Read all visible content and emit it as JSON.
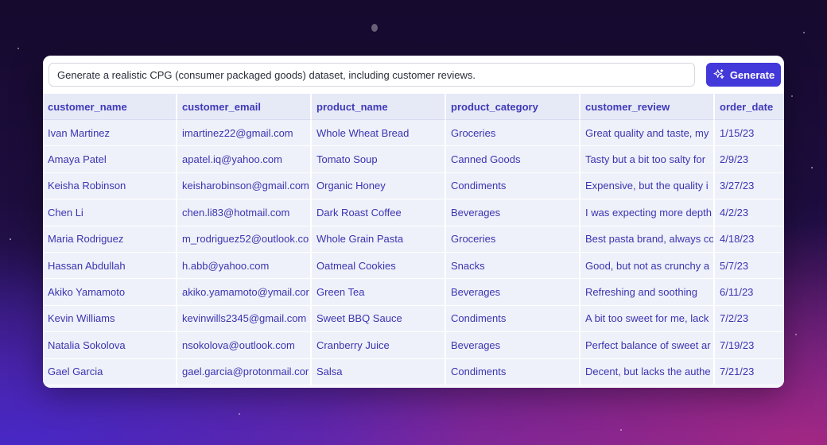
{
  "prompt": {
    "value": "Generate a realistic CPG (consumer packaged goods) dataset, including customer reviews.",
    "generate_label": "Generate",
    "generate_icon": "sparkles-icon"
  },
  "table": {
    "columns": [
      "customer_name",
      "customer_email",
      "product_name",
      "product_category",
      "customer_review",
      "order_date"
    ],
    "rows": [
      [
        "Ivan Martinez",
        "imartinez22@gmail.com",
        "Whole Wheat Bread",
        "Groceries",
        "Great quality and taste, my",
        "1/15/23"
      ],
      [
        "Amaya Patel",
        "apatel.iq@yahoo.com",
        "Tomato Soup",
        "Canned Goods",
        "Tasty but a bit too salty for",
        "2/9/23"
      ],
      [
        "Keisha Robinson",
        "keisharobinson@gmail.com",
        "Organic Honey",
        "Condiments",
        "Expensive, but the quality i",
        "3/27/23"
      ],
      [
        "Chen Li",
        "chen.li83@hotmail.com",
        "Dark Roast Coffee",
        "Beverages",
        "I was expecting more depth",
        "4/2/23"
      ],
      [
        "Maria Rodriguez",
        "m_rodriguez52@outlook.co",
        "Whole Grain Pasta",
        "Groceries",
        "Best pasta brand, always co",
        "4/18/23"
      ],
      [
        "Hassan Abdullah",
        "h.abb@yahoo.com",
        "Oatmeal Cookies",
        "Snacks",
        "Good, but not as crunchy a",
        "5/7/23"
      ],
      [
        "Akiko Yamamoto",
        "akiko.yamamoto@ymail.cor",
        "Green Tea",
        "Beverages",
        "Refreshing and soothing",
        "6/11/23"
      ],
      [
        "Kevin Williams",
        "kevinwills2345@gmail.com",
        "Sweet BBQ Sauce",
        "Condiments",
        "A bit too sweet for me, lack",
        "7/2/23"
      ],
      [
        "Natalia Sokolova",
        "nsokolova@outlook.com",
        "Cranberry Juice",
        "Beverages",
        "Perfect balance of sweet ar",
        "7/19/23"
      ],
      [
        "Gael Garcia",
        "gael.garcia@protonmail.cor",
        "Salsa",
        "Condiments",
        "Decent, but lacks the authe",
        "7/21/23"
      ]
    ]
  },
  "colors": {
    "accent": "#4338d9",
    "table_text": "#3a34b0",
    "header_bg": "#e6e9f6",
    "cell_bg": "#eff1fa"
  }
}
